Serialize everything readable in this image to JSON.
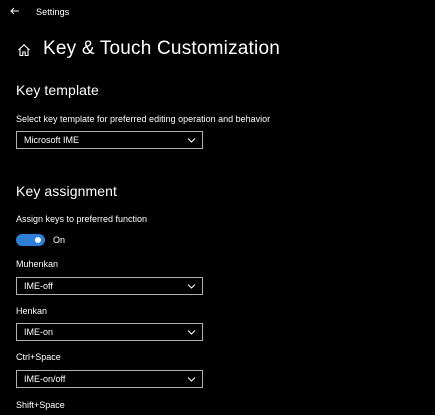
{
  "window": {
    "app_title": "Settings"
  },
  "header": {
    "title": "Key & Touch Customization"
  },
  "key_template": {
    "section_title": "Key template",
    "description": "Select key template for preferred editing operation and behavior",
    "selected": "Microsoft IME"
  },
  "key_assignment": {
    "section_title": "Key assignment",
    "toggle_label": "Assign keys to preferred function",
    "toggle_state": "On",
    "toggle_on": true,
    "accent_color": "#2f7fd8",
    "keys": [
      {
        "label": "Muhenkan",
        "value": "IME-off"
      },
      {
        "label": "Henkan",
        "value": "IME-on"
      },
      {
        "label": "Ctrl+Space",
        "value": "IME-on/off"
      },
      {
        "label": "Shift+Space",
        "value": ""
      }
    ]
  }
}
